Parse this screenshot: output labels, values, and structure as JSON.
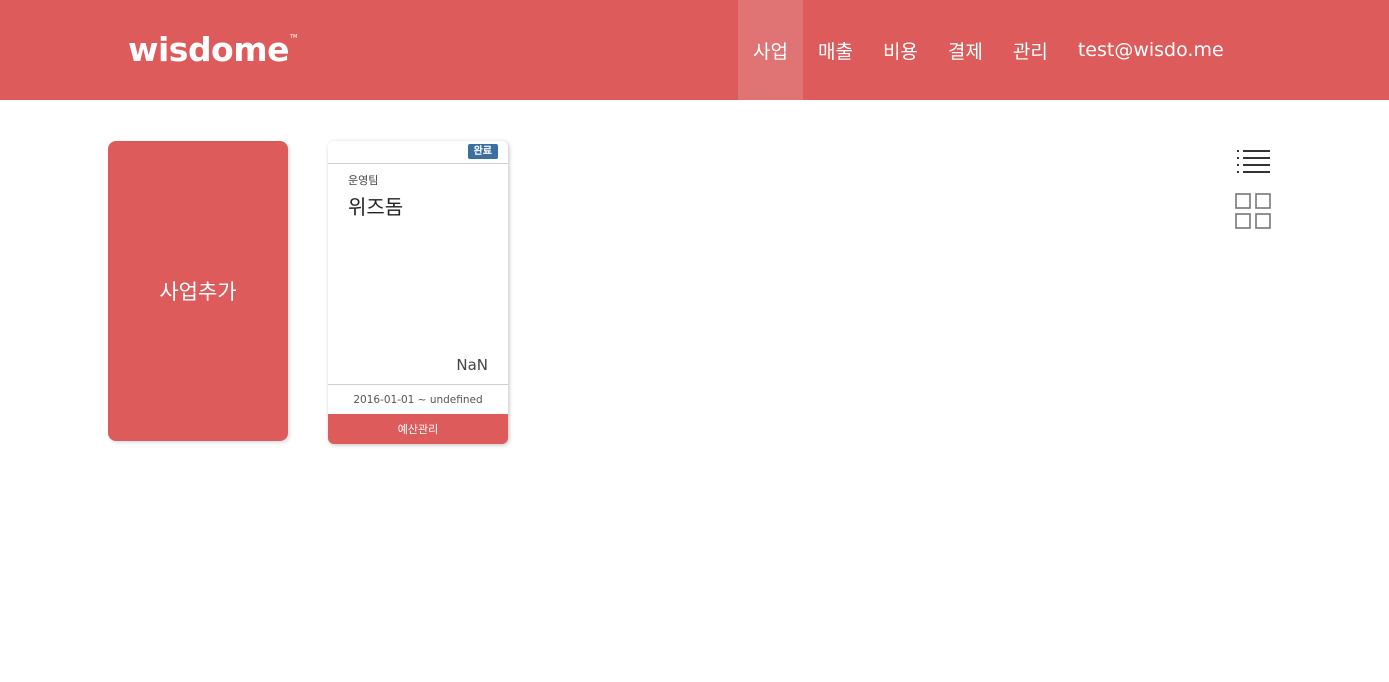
{
  "header": {
    "logo_text": "wisdome",
    "nav": [
      {
        "label": "사업",
        "active": true
      },
      {
        "label": "매출",
        "active": false
      },
      {
        "label": "비용",
        "active": false
      },
      {
        "label": "결제",
        "active": false
      },
      {
        "label": "관리",
        "active": false
      }
    ],
    "user_email": "test@wisdo.me"
  },
  "add_card": {
    "label": "사업추가"
  },
  "project": {
    "status_badge": "완료",
    "team": "운영팀",
    "name": "위즈돔",
    "amount": "NaN",
    "period": "2016-01-01 ~ undefined",
    "budget_button": "예산관리"
  },
  "view_toggles": {
    "list": "list-view-icon",
    "grid": "grid-view-icon"
  },
  "colors": {
    "brand": "#de5b5b",
    "nav_active": "#e07373",
    "badge": "#3b6f9f"
  }
}
